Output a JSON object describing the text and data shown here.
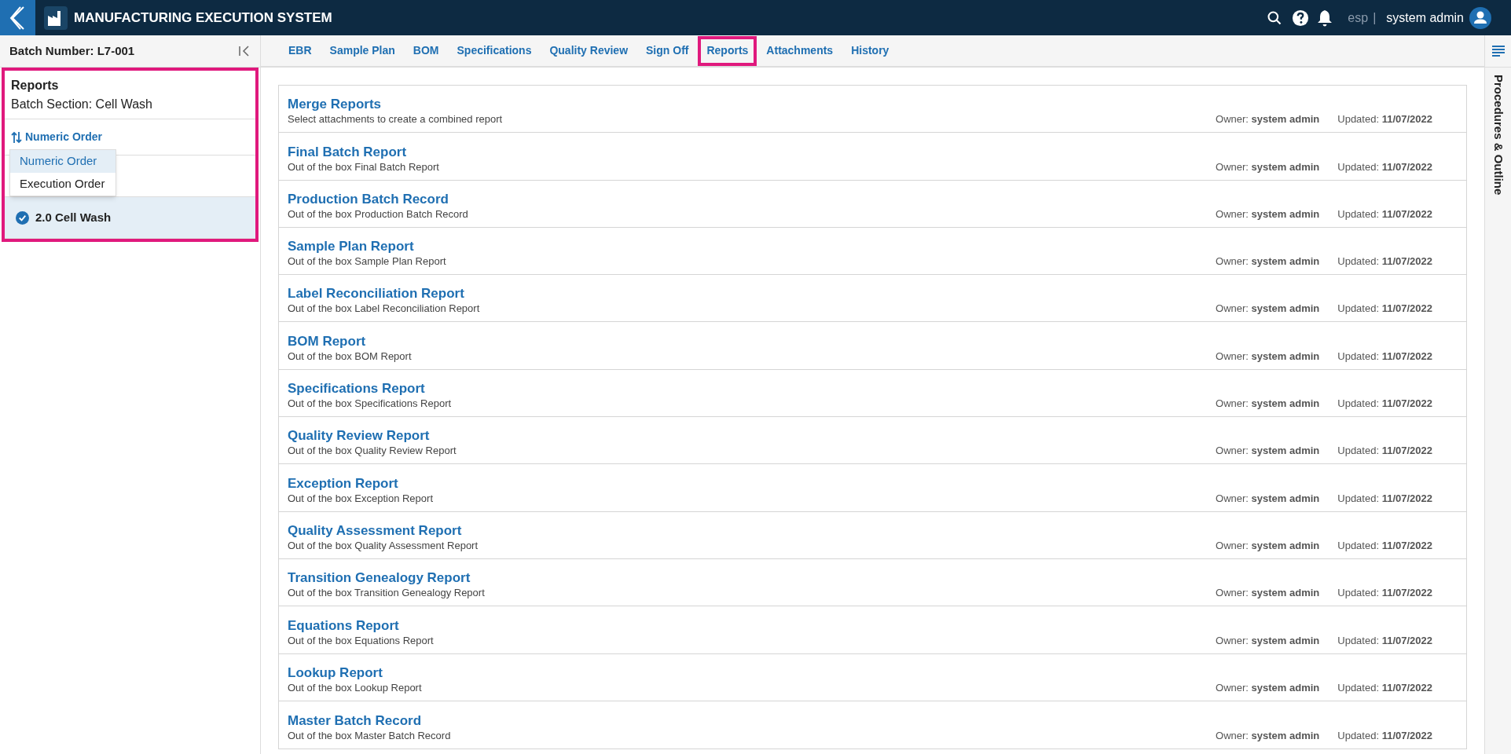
{
  "header": {
    "title": "MANUFACTURING EXECUTION SYSTEM",
    "language": "esp",
    "separator": "|",
    "user": "system admin"
  },
  "sidebar": {
    "batch_number": "Batch Number: L7-001",
    "highlighted": true,
    "title": "Reports",
    "subtitle": "Batch Section: Cell Wash",
    "sort_label": "Numeric Order",
    "sort_menu": [
      {
        "label": "Numeric Order",
        "selected": true
      },
      {
        "label": "Execution Order",
        "selected": false
      }
    ],
    "sections": [
      {
        "selected": false
      },
      {
        "label": "2.0 Cell Wash",
        "checked": true,
        "selected": true
      }
    ]
  },
  "tabs": [
    {
      "label": "EBR",
      "selected": false
    },
    {
      "label": "Sample Plan",
      "selected": false
    },
    {
      "label": "BOM",
      "selected": false
    },
    {
      "label": "Specifications",
      "selected": false
    },
    {
      "label": "Quality Review",
      "selected": false
    },
    {
      "label": "Sign Off",
      "selected": false
    },
    {
      "label": "Reports",
      "selected": true
    },
    {
      "label": "Attachments",
      "selected": false
    },
    {
      "label": "History",
      "selected": false
    }
  ],
  "reports": [
    {
      "title": "Merge Reports",
      "description": "Select attachments to create a combined report",
      "owner": "Owner: **system admin**",
      "updated": "Updated: **11/07/2022**"
    },
    {
      "title": "Final Batch Report",
      "description": "Out of the box Final Batch Report",
      "owner": "Owner: **system admin**",
      "updated": "Updated: **11/07/2022**"
    },
    {
      "title": "Production Batch Record",
      "description": "Out of the box Production Batch Record",
      "owner": "Owner: **system admin**",
      "updated": "Updated: **11/07/2022**"
    },
    {
      "title": "Sample Plan Report",
      "description": "Out of the box Sample Plan Report",
      "owner": "Owner: **system admin**",
      "updated": "Updated: **11/07/2022**"
    },
    {
      "title": "Label Reconciliation Report",
      "description": "Out of the box Label Reconciliation Report",
      "owner": "Owner: **system admin**",
      "updated": "Updated: **11/07/2022**"
    },
    {
      "title": "BOM Report",
      "description": "Out of the box BOM Report",
      "owner": "Owner: **system admin**",
      "updated": "Updated: **11/07/2022**"
    },
    {
      "title": "Specifications Report",
      "description": "Out of the box Specifications Report",
      "owner": "Owner: **system admin**",
      "updated": "Updated: **11/07/2022**"
    },
    {
      "title": "Quality Review Report",
      "description": "Out of the box Quality Review Report",
      "owner": "Owner: **system admin**",
      "updated": "Updated: **11/07/2022**"
    },
    {
      "title": "Exception Report",
      "description": "Out of the box Exception Report",
      "owner": "Owner: **system admin**",
      "updated": "Updated: **11/07/2022**"
    },
    {
      "title": "Quality Assessment Report",
      "description": "Out of the box Quality Assessment Report",
      "owner": "Owner: **system admin**",
      "updated": "Updated: **11/07/2022**"
    },
    {
      "title": "Transition Genealogy Report",
      "description": "Out of the box Transition Genealogy Report",
      "owner": "Owner: **system admin**",
      "updated": "Updated: **11/07/2022**"
    },
    {
      "title": "Equations Report",
      "description": "Out of the box Equations Report",
      "owner": "Owner: **system admin**",
      "updated": "Updated: **11/07/2022**"
    },
    {
      "title": "Lookup Report",
      "description": "Out of the box Lookup Report",
      "owner": "Owner: **system admin**",
      "updated": "Updated: **11/07/2022**"
    },
    {
      "title": "Master Batch Record",
      "description": "Out of the box Master Batch Record",
      "owner": "Owner: **system admin**",
      "updated": "Updated: **11/07/2022**"
    }
  ],
  "right_rail": {
    "label": "Procedures & Outline"
  }
}
